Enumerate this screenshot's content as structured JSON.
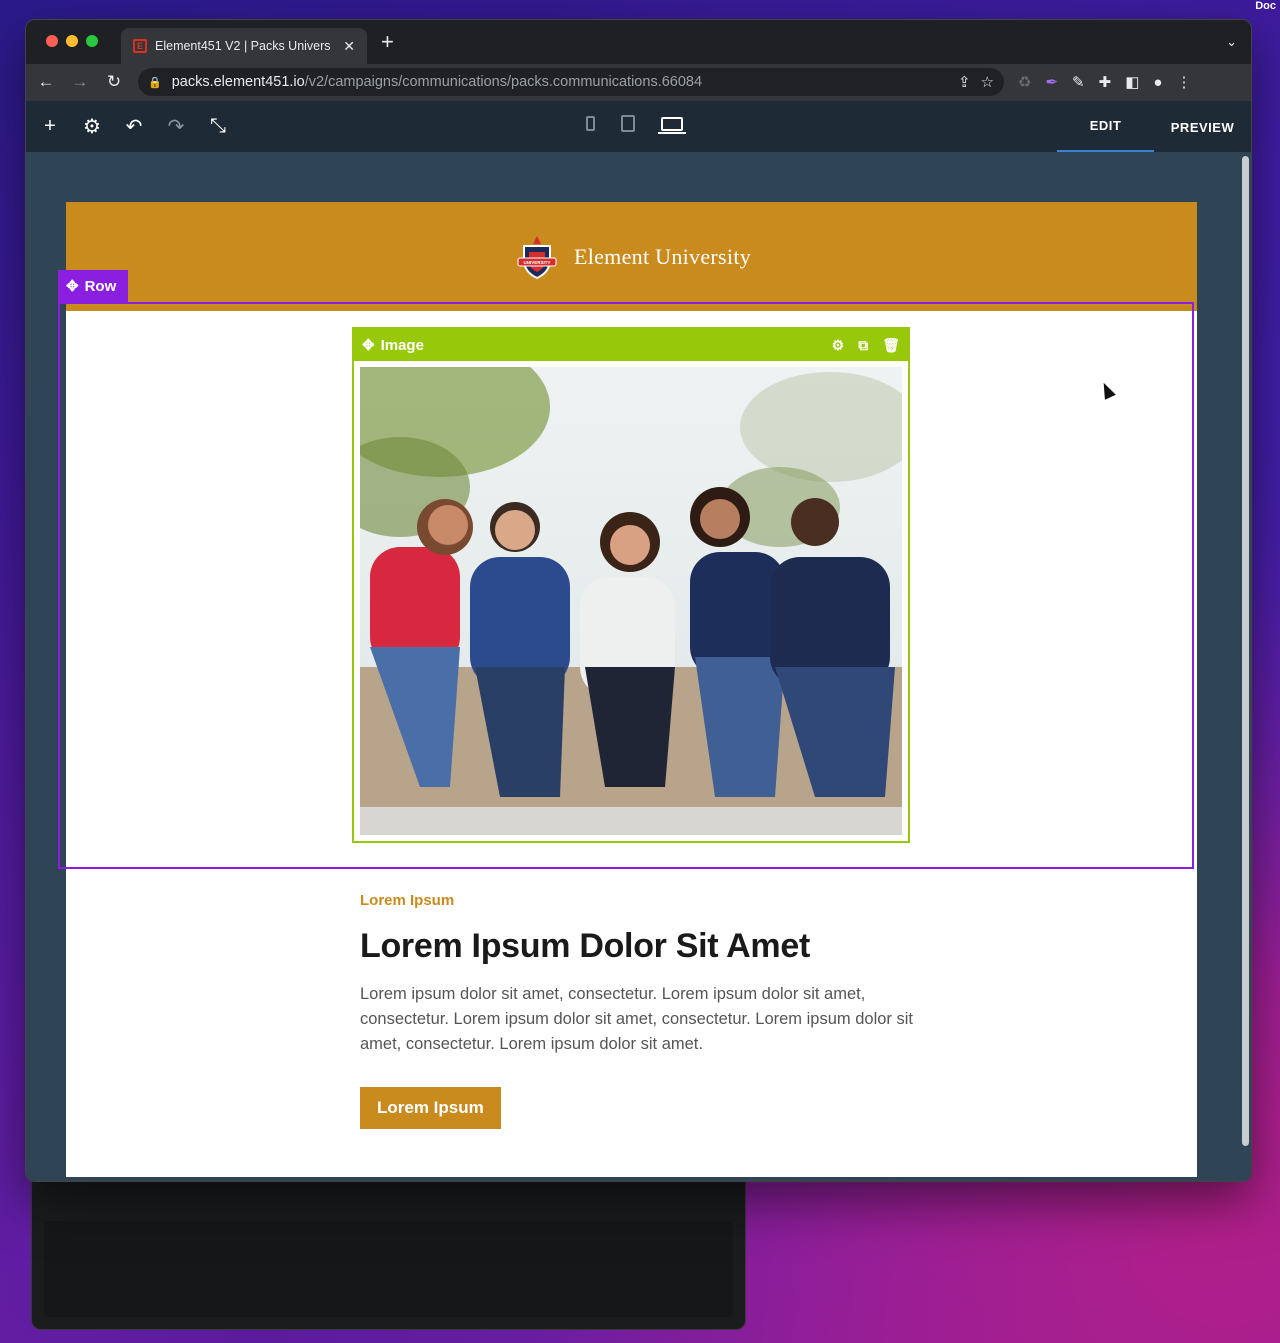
{
  "browser": {
    "tab_title": "Element451 V2 | Packs Univers",
    "url_host": "packs.element451.io",
    "url_path": "/v2/campaigns/communications/packs.communications.66084"
  },
  "editor": {
    "modes": [
      "EDIT",
      "PREVIEW"
    ],
    "active_mode": "EDIT",
    "active_device": "desktop"
  },
  "email": {
    "brand_name": "Element University",
    "crest_text": "UNIVERSITY",
    "row_label": "Row",
    "image_label": "Image",
    "eyebrow": "Lorem Ipsum",
    "headline": "Lorem Ipsum Dolor Sit Amet",
    "body": "Lorem ipsum dolor sit amet, consectetur. Lorem ipsum dolor sit amet, consectetur. Lorem ipsum dolor sit amet, consectetur. Lorem ipsum dolor sit amet, consectetur. Lorem ipsum dolor sit amet.",
    "cta_label": "Lorem Ipsum"
  },
  "colors": {
    "brand_gold": "#c98a1e",
    "row_outline": "#8b1fe0",
    "image_outline": "#98c80a",
    "edit_underline": "#3b82d6"
  }
}
